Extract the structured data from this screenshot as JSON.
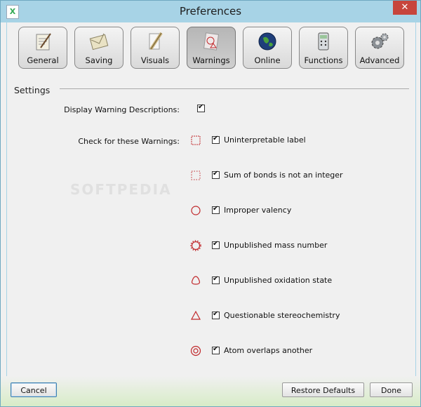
{
  "window": {
    "title": "Preferences",
    "app_icon": "chemdraw-app-icon",
    "close_label": "✕"
  },
  "tabs": [
    {
      "label": "General",
      "icon": "notepad-icon",
      "active": false
    },
    {
      "label": "Saving",
      "icon": "envelope-icon",
      "active": false
    },
    {
      "label": "Visuals",
      "icon": "ruler-pencil-icon",
      "active": false
    },
    {
      "label": "Warnings",
      "icon": "warning-sheet-icon",
      "active": true
    },
    {
      "label": "Online",
      "icon": "globe-icon",
      "active": false
    },
    {
      "label": "Functions",
      "icon": "calculator-icon",
      "active": false
    },
    {
      "label": "Advanced",
      "icon": "gears-icon",
      "active": false
    }
  ],
  "settings": {
    "section_title": "Settings",
    "display_descriptions_label": "Display Warning Descriptions:",
    "display_descriptions_checked": true,
    "check_warnings_label": "Check for these Warnings:",
    "watermark": "SOFTPEDIA",
    "warnings": [
      {
        "label": "Uninterpretable label",
        "symbol": "jagged-square-icon",
        "checked": true
      },
      {
        "label": "Sum of bonds is not an integer",
        "symbol": "dotted-square-icon",
        "checked": true
      },
      {
        "label": "Improper valency",
        "symbol": "circle-icon",
        "checked": true
      },
      {
        "label": "Unpublished mass number",
        "symbol": "gear-shape-icon",
        "checked": true
      },
      {
        "label": "Unpublished oxidation state",
        "symbol": "rounded-triangle-icon",
        "checked": true
      },
      {
        "label": "Questionable stereochemistry",
        "symbol": "triangle-icon",
        "checked": true
      },
      {
        "label": "Atom overlaps another",
        "symbol": "double-circle-icon",
        "checked": true
      }
    ]
  },
  "footer": {
    "cancel_label": "Cancel",
    "restore_label": "Restore Defaults",
    "done_label": "Done"
  },
  "colors": {
    "title_bar": "#a7d3e6",
    "warning_red": "#c0282b",
    "footer_green": "#d8ecc7"
  }
}
